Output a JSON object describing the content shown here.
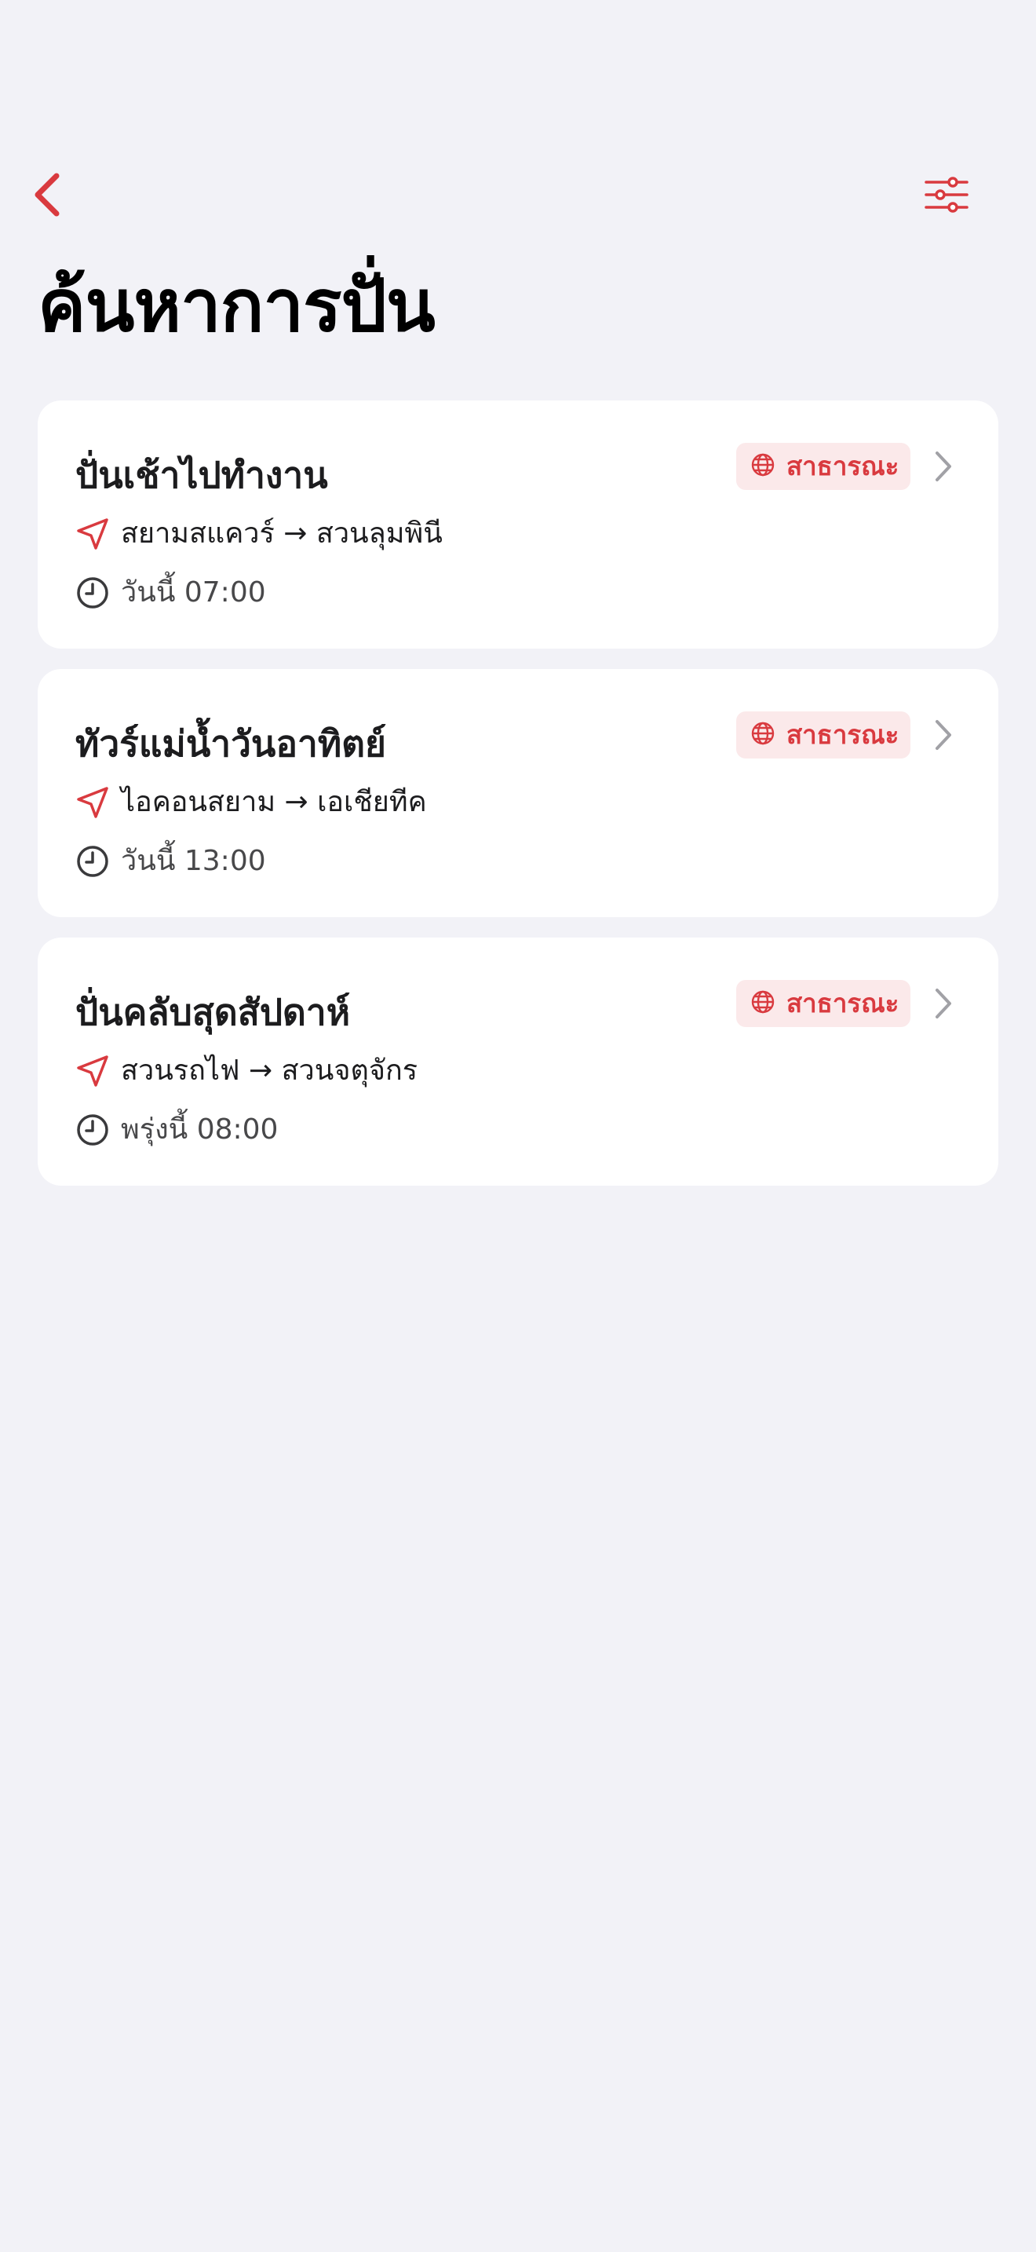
{
  "page": {
    "title": "ค้นหาการปั่น"
  },
  "colors": {
    "accent": "#d93a3f",
    "badge_bg": "#fbe9ea",
    "background": "#f2f2f7",
    "card": "#ffffff",
    "chevron": "#a1a1a6"
  },
  "icons": {
    "back": "chevron-left-icon",
    "filter": "sliders-icon",
    "visibility": "globe-icon",
    "route": "navigation-arrow-icon",
    "time": "clock-icon",
    "disclosure": "chevron-right-icon"
  },
  "rides": [
    {
      "title": "ปั่นเช้าไปทำงาน",
      "visibility": "สาธารณะ",
      "route": "สยามสแควร์ → สวนลุมพินี",
      "time": "วันนี้ 07:00"
    },
    {
      "title": "ทัวร์แม่น้ำวันอาทิตย์",
      "visibility": "สาธารณะ",
      "route": "ไอคอนสยาม → เอเชียทีค",
      "time": "วันนี้ 13:00"
    },
    {
      "title": "ปั่นคลับสุดสัปดาห์",
      "visibility": "สาธารณะ",
      "route": "สวนรถไฟ → สวนจตุจักร",
      "time": "พรุ่งนี้ 08:00"
    }
  ]
}
